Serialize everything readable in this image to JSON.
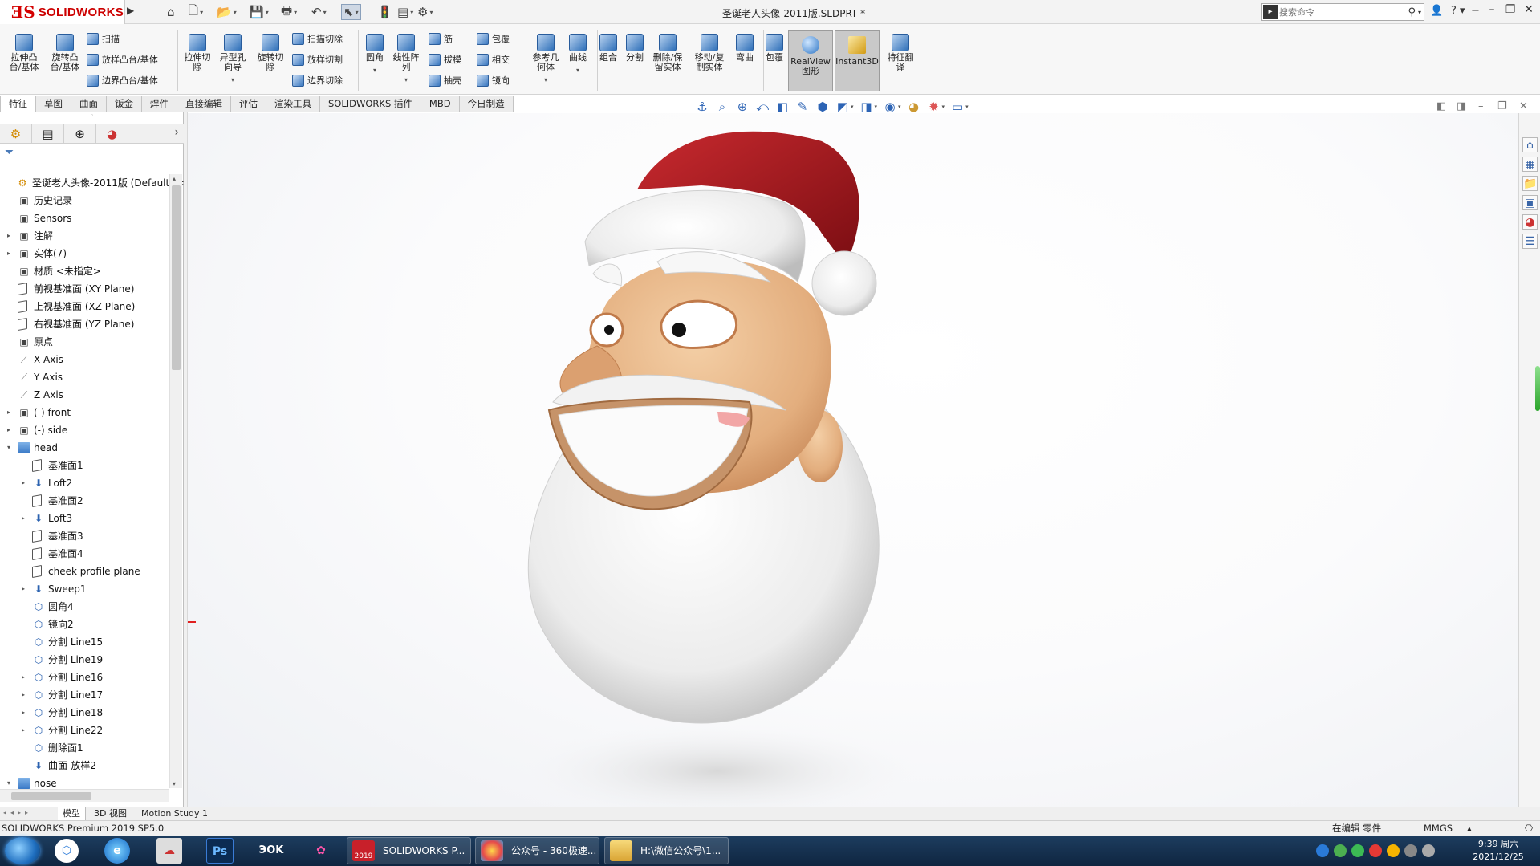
{
  "app": {
    "brand": "SOLIDWORKS",
    "document_title": "圣诞老人头像-2011版.SLDPRT *",
    "search_placeholder": "搜索命令"
  },
  "command_manager": {
    "extrude_boss": "拉伸凸\n台/基体",
    "revolve_boss": "旋转凸\n台/基体",
    "sweep": "扫描",
    "loft_boss": "放样凸台/基体",
    "boundary_boss": "边界凸台/基体",
    "extrude_cut": "拉伸切\n除",
    "hole_wizard": "异型孔\n向导",
    "revolve_cut": "旋转切\n除",
    "swept_cut": "扫描切除",
    "lofted_cut": "放样切割",
    "boundary_cut": "边界切除",
    "fillet": "圆角",
    "linear_pattern": "线性阵\n列",
    "rib": "筋",
    "draft": "拔模",
    "shell": "抽壳",
    "wrap": "包覆",
    "intersect": "相交",
    "mirror": "镜向",
    "ref_geometry": "参考几\n何体",
    "curves": "曲线",
    "combine": "组合",
    "split": "分割",
    "delete_keep_body": "删除/保\n留实体",
    "move_copy_body": "移动/复\n制实体",
    "flex": "弯曲",
    "wrap2": "包覆",
    "realview": "RealView\n图形",
    "instant3d": "Instant3D",
    "feature_works": "特征翻\n译"
  },
  "tabs": [
    "特征",
    "草图",
    "曲面",
    "钣金",
    "焊件",
    "直接编辑",
    "评估",
    "渲染工具",
    "SOLIDWORKS 插件",
    "MBD",
    "今日制造"
  ],
  "tree": [
    {
      "label": "圣诞老人头像-2011版  (Default<<",
      "icon": "part-icon",
      "level": 0,
      "expand": "",
      "cls": "part"
    },
    {
      "label": "历史记录",
      "icon": "history-icon",
      "level": 1,
      "expand": "",
      "cls": ""
    },
    {
      "label": "Sensors",
      "icon": "sensors-icon",
      "level": 1,
      "expand": "",
      "cls": ""
    },
    {
      "label": "注解",
      "icon": "annotations-icon",
      "level": 1,
      "expand": "▸",
      "cls": ""
    },
    {
      "label": "实体(7)",
      "icon": "solid-bodies-icon",
      "level": 1,
      "expand": "▸",
      "cls": ""
    },
    {
      "label": "材质 <未指定>",
      "icon": "material-icon",
      "level": 1,
      "expand": "",
      "cls": ""
    },
    {
      "label": "前视基准面 (XY Plane)",
      "icon": "plane-icon",
      "level": 1,
      "expand": "",
      "cls": "plane"
    },
    {
      "label": "上视基准面 (XZ Plane)",
      "icon": "plane-icon",
      "level": 1,
      "expand": "",
      "cls": "plane"
    },
    {
      "label": "右视基准面 (YZ Plane)",
      "icon": "plane-icon",
      "level": 1,
      "expand": "",
      "cls": "plane"
    },
    {
      "label": "原点",
      "icon": "origin-icon",
      "level": 1,
      "expand": "",
      "cls": ""
    },
    {
      "label": "X Axis",
      "icon": "axis-icon",
      "level": 1,
      "expand": "",
      "cls": "axis"
    },
    {
      "label": "Y Axis",
      "icon": "axis-icon",
      "level": 1,
      "expand": "",
      "cls": "axis"
    },
    {
      "label": "Z Axis",
      "icon": "axis-icon",
      "level": 1,
      "expand": "",
      "cls": "axis"
    },
    {
      "label": "(-) front",
      "icon": "sketch-icon",
      "level": 1,
      "expand": "▸",
      "cls": ""
    },
    {
      "label": "(-) side",
      "icon": "sketch-icon",
      "level": 1,
      "expand": "▸",
      "cls": ""
    },
    {
      "label": "head",
      "icon": "folder-icon",
      "level": 1,
      "expand": "▾",
      "cls": "folder"
    },
    {
      "label": "基准面1",
      "icon": "plane-icon",
      "level": 2,
      "expand": "",
      "cls": "plane"
    },
    {
      "label": "Loft2",
      "icon": "loft-icon",
      "level": 2,
      "expand": "▸",
      "cls": "loft"
    },
    {
      "label": "基准面2",
      "icon": "plane-icon",
      "level": 2,
      "expand": "",
      "cls": "plane"
    },
    {
      "label": "Loft3",
      "icon": "loft-icon",
      "level": 2,
      "expand": "▸",
      "cls": "loft"
    },
    {
      "label": "基准面3",
      "icon": "plane-icon",
      "level": 2,
      "expand": "",
      "cls": "plane"
    },
    {
      "label": "基准面4",
      "icon": "plane-icon",
      "level": 2,
      "expand": "",
      "cls": "plane"
    },
    {
      "label": "cheek profile plane",
      "icon": "plane-icon",
      "level": 2,
      "expand": "",
      "cls": "plane"
    },
    {
      "label": "Sweep1",
      "icon": "sweep-icon",
      "level": 2,
      "expand": "▸",
      "cls": "loft"
    },
    {
      "label": "圆角4",
      "icon": "fillet-icon",
      "level": 2,
      "expand": "",
      "cls": "split"
    },
    {
      "label": "镜向2",
      "icon": "mirror-icon",
      "level": 2,
      "expand": "",
      "cls": "split"
    },
    {
      "label": "分割 Line15",
      "icon": "split-line-icon",
      "level": 2,
      "expand": "",
      "cls": "split"
    },
    {
      "label": "分割 Line19",
      "icon": "split-line-icon",
      "level": 2,
      "expand": "",
      "cls": "split"
    },
    {
      "label": "分割 Line16",
      "icon": "split-line-icon",
      "level": 2,
      "expand": "▸",
      "cls": "split"
    },
    {
      "label": "分割 Line17",
      "icon": "split-line-icon",
      "level": 2,
      "expand": "▸",
      "cls": "split"
    },
    {
      "label": "分割 Line18",
      "icon": "split-line-icon",
      "level": 2,
      "expand": "▸",
      "cls": "split"
    },
    {
      "label": "分割 Line22",
      "icon": "split-line-icon",
      "level": 2,
      "expand": "▸",
      "cls": "split"
    },
    {
      "label": "删除面1",
      "icon": "delete-face-icon",
      "level": 2,
      "expand": "",
      "cls": "split"
    },
    {
      "label": "曲面-放样2",
      "icon": "surface-loft-icon",
      "level": 2,
      "expand": "",
      "cls": "loft"
    },
    {
      "label": "nose",
      "icon": "folder-icon",
      "level": 1,
      "expand": "▾",
      "cls": "folder"
    }
  ],
  "bottom_tabs": [
    "模型",
    "3D 视图",
    "Motion Study 1"
  ],
  "status": {
    "product": "SOLIDWORKS Premium 2019 SP5.0",
    "editing": "在编辑 零件",
    "units": "MMGS"
  },
  "taskbar": {
    "apps": [
      {
        "label": "SOLIDWORKS P...",
        "color": "#c8202a",
        "icon": "solidworks-icon"
      },
      {
        "label": "公众号 - 360极速...",
        "color": "#3aa0e0",
        "icon": "browser-icon"
      },
      {
        "label": "H:\\微信公众号\\1...",
        "color": "#e0b84a",
        "icon": "folder-icon"
      }
    ],
    "pinned": [
      "Ps",
      "ЭOK"
    ],
    "sw_badge": "2019",
    "clock_time": "9:39 周六",
    "clock_date": "2021/12/25"
  },
  "colors": {
    "brand_red": "#c00000",
    "hat_red": "#a3151b",
    "fur_white": "#f2f2f2",
    "skin": "#e8b98a"
  }
}
